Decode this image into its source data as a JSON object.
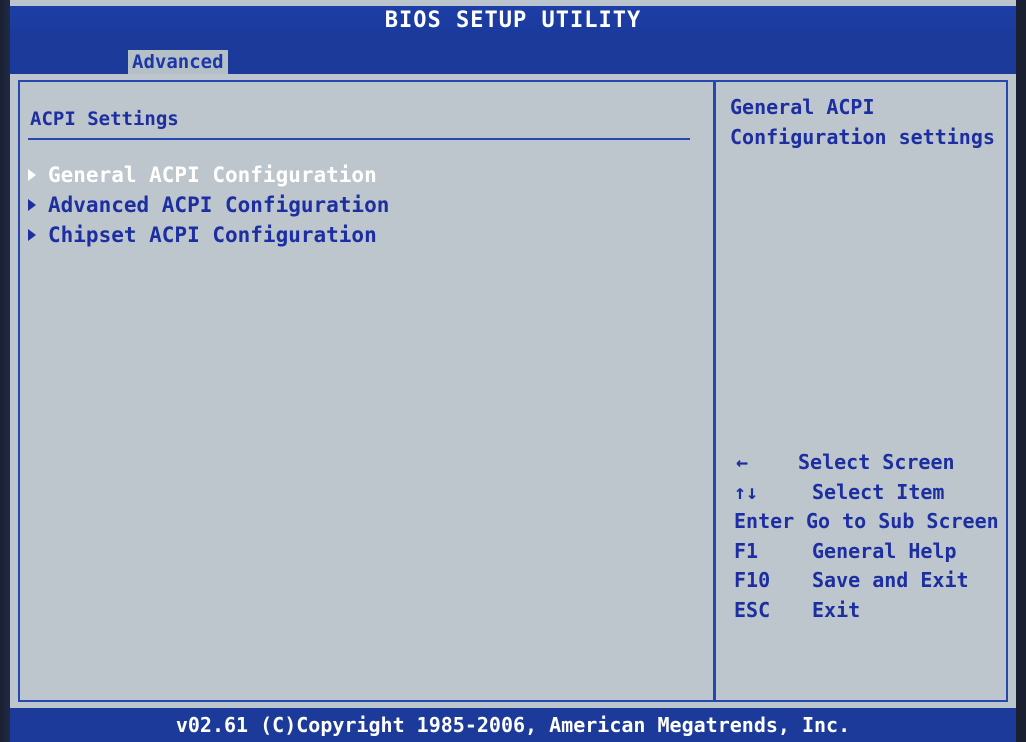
{
  "header": {
    "title": "BIOS SETUP UTILITY",
    "tabs": [
      {
        "label": "Advanced"
      }
    ]
  },
  "left_panel": {
    "title": "ACPI Settings",
    "items": [
      {
        "label": "General ACPI Configuration",
        "selected": true
      },
      {
        "label": "Advanced ACPI Configuration",
        "selected": false
      },
      {
        "label": "Chipset ACPI Configuration",
        "selected": false
      }
    ]
  },
  "help": {
    "line1": "General ACPI",
    "line2": "Configuration settings"
  },
  "keys": [
    {
      "key": "←",
      "desc": "Select Screen"
    },
    {
      "key": "↑↓",
      "desc": "Select Item"
    },
    {
      "key": "Enter",
      "desc": "Go to Sub Screen"
    },
    {
      "key": "F1",
      "desc": "General Help"
    },
    {
      "key": "F10",
      "desc": "Save and Exit"
    },
    {
      "key": "ESC",
      "desc": "Exit"
    }
  ],
  "footer": {
    "text": "v02.61 (C)Copyright 1985-2006, American Megatrends, Inc."
  },
  "colors": {
    "bar_blue": "#1b3a9a",
    "panel_gray": "#bcc6cc",
    "text_blue": "#1d2fa0",
    "selected_text": "#ffffff"
  }
}
